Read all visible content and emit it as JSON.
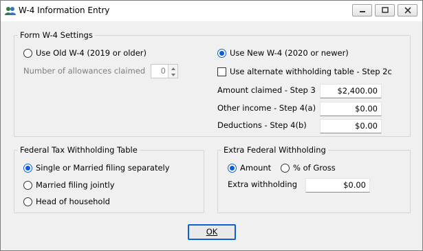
{
  "window": {
    "title": "W-4 Information Entry"
  },
  "w4_settings": {
    "group_label": "Form W-4 Settings",
    "old_w4_label": "Use Old W-4 (2019 or older)",
    "old_w4_selected": false,
    "allowances_label": "Number of allowances claimed",
    "allowances_value": "0",
    "new_w4_label": "Use New W-4 (2020 or newer)",
    "new_w4_selected": true,
    "alternate_table_label": "Use alternate withholding table - Step 2c",
    "alternate_table_checked": false,
    "amount_claimed_label": "Amount claimed - Step 3",
    "amount_claimed_value": "$2,400.00",
    "other_income_label": "Other income - Step 4(a)",
    "other_income_value": "$0.00",
    "deductions_label": "Deductions - Step 4(b)",
    "deductions_value": "$0.00"
  },
  "federal_table": {
    "group_label": "Federal Tax Withholding Table",
    "options": [
      {
        "label": "Single or Married filing separately",
        "selected": true
      },
      {
        "label": "Married filing jointly",
        "selected": false
      },
      {
        "label": "Head of household",
        "selected": false
      }
    ]
  },
  "extra_withholding": {
    "group_label": "Extra Federal Withholding",
    "amount_label": "Amount",
    "amount_selected": true,
    "percent_label": "% of Gross",
    "percent_selected": false,
    "extra_label": "Extra withholding",
    "extra_value": "$0.00"
  },
  "buttons": {
    "ok_label": "OK"
  },
  "colors": {
    "accent": "#0a5fd3",
    "window_bg": "#f0f0f0"
  }
}
